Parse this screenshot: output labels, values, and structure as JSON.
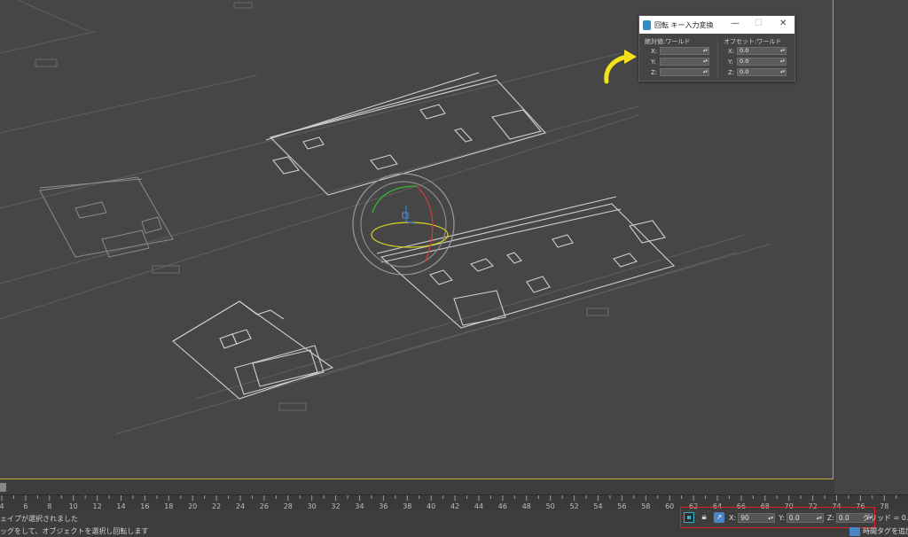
{
  "dialog": {
    "title": "回転 キー入力変換",
    "minimize": "—",
    "maximize": "☐",
    "close": "✕",
    "absolute_title": "絶対値:ワールド",
    "offset_title": "オフセット:ワールド",
    "absolute_fields": [
      {
        "label": "X:",
        "value": ""
      },
      {
        "label": "Y:",
        "value": ""
      },
      {
        "label": "Z:",
        "value": ""
      }
    ],
    "offset_fields": [
      {
        "label": "X:",
        "value": "0.0"
      },
      {
        "label": "Y:",
        "value": "0.0"
      },
      {
        "label": "Z:",
        "value": "0.0"
      }
    ]
  },
  "timeline": {
    "ticks": [
      "4",
      "6",
      "8",
      "10",
      "12",
      "14",
      "16",
      "18",
      "20",
      "22",
      "24",
      "26",
      "28",
      "30",
      "32",
      "34",
      "36",
      "38",
      "40",
      "42",
      "44",
      "46",
      "48",
      "50",
      "52",
      "54",
      "56",
      "58",
      "60",
      "62",
      "64",
      "66",
      "68",
      "70",
      "72",
      "74",
      "76",
      "78"
    ]
  },
  "status": {
    "line1": "ェイプが選択されました",
    "line2": "ッグをして、オブジェクトを選択し回転します"
  },
  "coords": {
    "x_label": "X:",
    "x_value": "90",
    "y_label": "Y:",
    "y_value": "0.0",
    "z_label": "Z:",
    "z_value": "0.0",
    "grid_label": "グリッド = 0.0mm",
    "time_tag": "時間タグを追加"
  },
  "colors": {
    "viewport_bg": "#464646",
    "viewport_border": "#c9a43a",
    "highlight_box": "#e02020",
    "annotation_arrow": "#f5e11a",
    "accent_blue": "#4a86c7"
  },
  "icons": {
    "selection_lock": "selection-lock-icon",
    "lock": "lock-icon",
    "offset_mode": "offset-mode-icon",
    "app": "app-icon"
  }
}
